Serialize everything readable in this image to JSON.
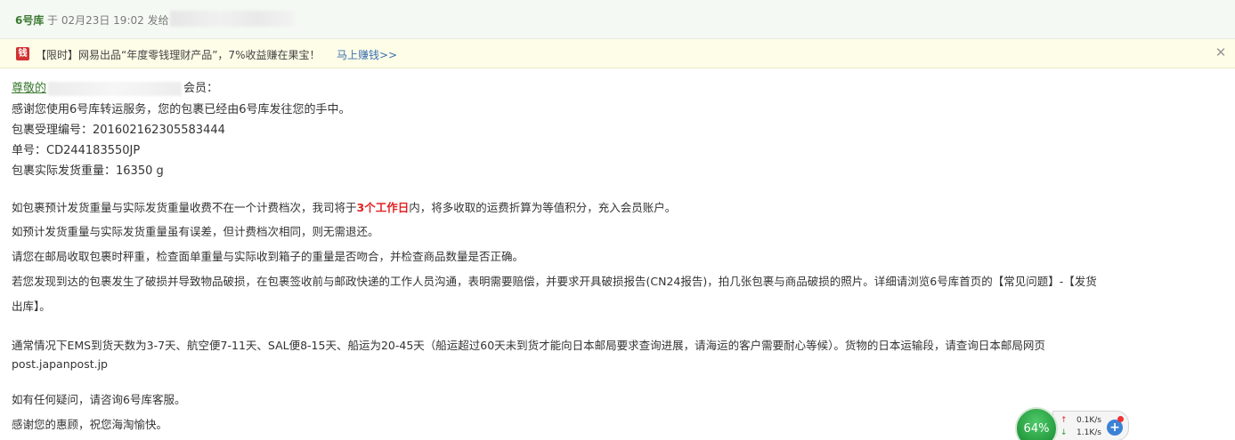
{
  "header": {
    "sender": "6号库",
    "meta": "于 02月23日 19:02 发给"
  },
  "promo": {
    "logo_text": "钱",
    "text": "【限时】网易出品“年度零钱理财产品”，7%收益赚在果宝！",
    "link": "马上赚钱>>",
    "close": "✕"
  },
  "email": {
    "greeting_prefix": "尊敬的",
    "greeting_suffix": "会员：",
    "line_thanks": "感谢您使用6号库转运服务，您的包裹已经由6号库发往您的手中。",
    "line_accept_no": "包裹受理编号：201602162305583444",
    "line_order_no": "单号：CD244183550JP",
    "line_weight": "包裹实际发货重量：16350 g",
    "para1_a": "如包裹预计发货重量与实际发货重量收费不在一个计费档次，我司将于",
    "para1_red": "3个工作日",
    "para1_b": "内，将多收取的运费折算为等值积分，充入会员账户。",
    "para2": "如预计发货重量与实际发货重量虽有误差，但计费档次相同，则无需退还。",
    "para3": "请您在邮局收取包裹时秤重，检查面单重量与实际收到箱子的重量是否吻合，并检查商品数量是否正确。",
    "para4_a": "若您发现到达的包裹发生了破损并导致物品破损，在包裹签收前与邮政快递的工作人员沟通，表明需要赔偿，并要求开具破损报告(CN24报告)，拍几张包裹与商品破损的照片。详细请浏览6号库首页的【常见问题】-【发货",
    "para4_b": "出库】。",
    "para5_a": "通常情况下EMS到货天数为3-7天、航空便7-11天、SAL便8-15天、船运为20-45天（船运超过60天未到货才能向日本邮局要求查询进展，请海运的客户需要耐心等候）。货物的日本运输段，请查询日本邮局网页",
    "para5_b": "post.japanpost.jp",
    "para6": "如有任何疑问，请咨询6号库客服。",
    "para7": "感谢您的惠顾，祝您海淘愉快。"
  },
  "net_widget": {
    "percent": "64%",
    "up_arrow": "↑",
    "down_arrow": "↓",
    "up_speed": "0.1K/s",
    "down_speed": "1.1K/s",
    "plus": "+"
  },
  "colors": {
    "accent_green": "#3b7a31",
    "highlight_red": "#e02222",
    "promo_bg": "#fdfde8"
  }
}
